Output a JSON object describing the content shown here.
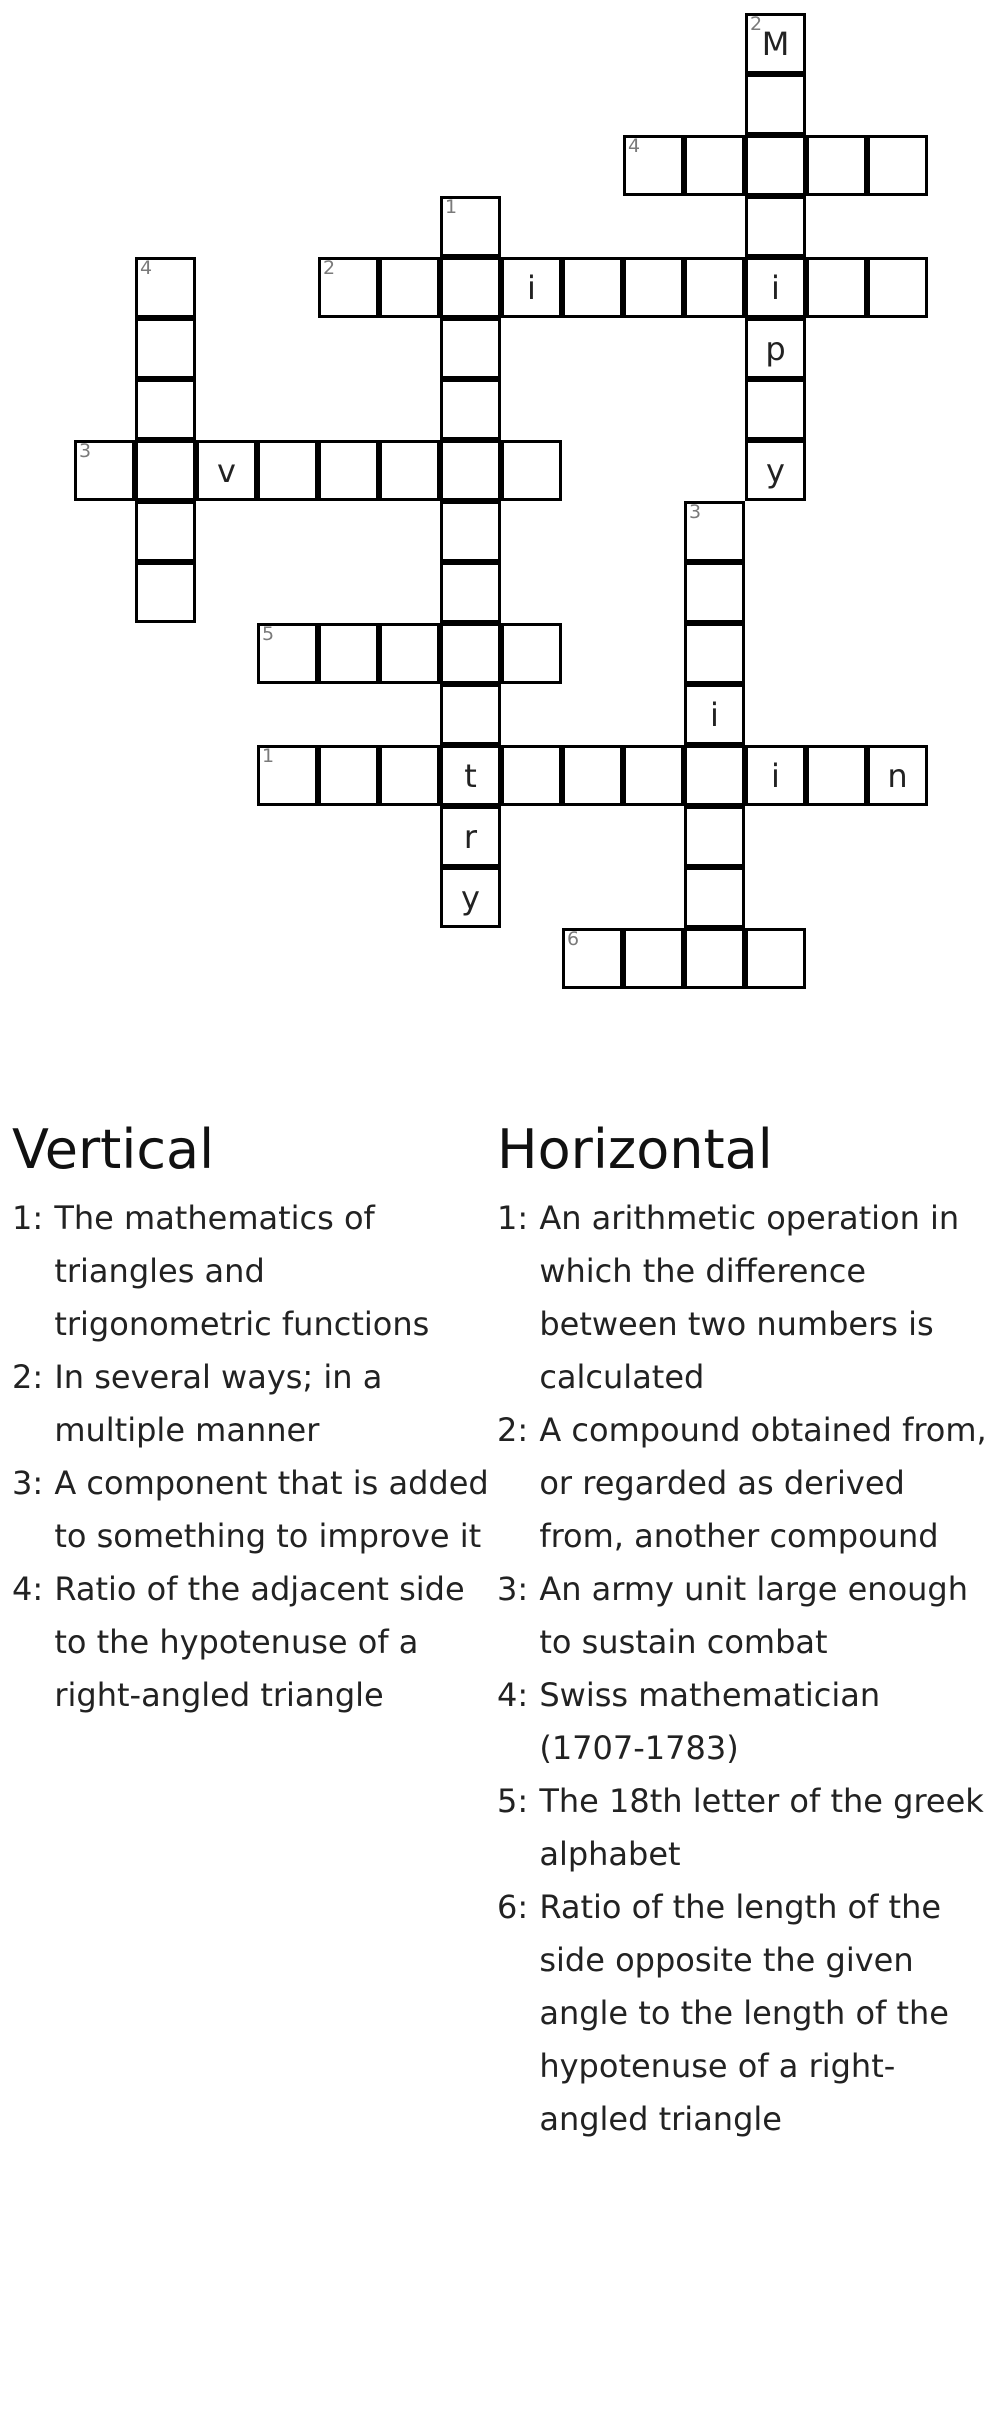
{
  "crossword": {
    "cells": [
      {
        "col": 12,
        "row": 0,
        "num": "2",
        "letter": "M"
      },
      {
        "col": 12,
        "row": 1
      },
      {
        "col": 10,
        "row": 2,
        "num": "4"
      },
      {
        "col": 11,
        "row": 2
      },
      {
        "col": 12,
        "row": 2
      },
      {
        "col": 13,
        "row": 2
      },
      {
        "col": 14,
        "row": 2
      },
      {
        "col": 7,
        "row": 3,
        "num": "1"
      },
      {
        "col": 12,
        "row": 3
      },
      {
        "col": 2,
        "row": 4,
        "num": "4"
      },
      {
        "col": 5,
        "row": 4,
        "num": "2"
      },
      {
        "col": 6,
        "row": 4
      },
      {
        "col": 7,
        "row": 4
      },
      {
        "col": 8,
        "row": 4,
        "letter": "i"
      },
      {
        "col": 9,
        "row": 4
      },
      {
        "col": 10,
        "row": 4
      },
      {
        "col": 11,
        "row": 4
      },
      {
        "col": 12,
        "row": 4,
        "letter": "i"
      },
      {
        "col": 13,
        "row": 4
      },
      {
        "col": 14,
        "row": 4
      },
      {
        "col": 2,
        "row": 5
      },
      {
        "col": 7,
        "row": 5
      },
      {
        "col": 12,
        "row": 5,
        "letter": "p"
      },
      {
        "col": 2,
        "row": 6
      },
      {
        "col": 7,
        "row": 6
      },
      {
        "col": 12,
        "row": 6
      },
      {
        "col": 1,
        "row": 7,
        "num": "3"
      },
      {
        "col": 2,
        "row": 7
      },
      {
        "col": 3,
        "row": 7,
        "letter": "v"
      },
      {
        "col": 4,
        "row": 7
      },
      {
        "col": 5,
        "row": 7
      },
      {
        "col": 6,
        "row": 7
      },
      {
        "col": 7,
        "row": 7
      },
      {
        "col": 8,
        "row": 7
      },
      {
        "col": 12,
        "row": 7,
        "letter": "y"
      },
      {
        "col": 2,
        "row": 8
      },
      {
        "col": 7,
        "row": 8
      },
      {
        "col": 11,
        "row": 8,
        "num": "3"
      },
      {
        "col": 2,
        "row": 9
      },
      {
        "col": 7,
        "row": 9
      },
      {
        "col": 11,
        "row": 9
      },
      {
        "col": 4,
        "row": 10,
        "num": "5"
      },
      {
        "col": 5,
        "row": 10
      },
      {
        "col": 6,
        "row": 10
      },
      {
        "col": 7,
        "row": 10
      },
      {
        "col": 8,
        "row": 10
      },
      {
        "col": 11,
        "row": 10
      },
      {
        "col": 7,
        "row": 11
      },
      {
        "col": 11,
        "row": 11,
        "letter": "i"
      },
      {
        "col": 4,
        "row": 12,
        "num": "1"
      },
      {
        "col": 5,
        "row": 12
      },
      {
        "col": 6,
        "row": 12
      },
      {
        "col": 7,
        "row": 12,
        "letter": "t"
      },
      {
        "col": 8,
        "row": 12
      },
      {
        "col": 9,
        "row": 12
      },
      {
        "col": 10,
        "row": 12
      },
      {
        "col": 11,
        "row": 12
      },
      {
        "col": 12,
        "row": 12,
        "letter": "i"
      },
      {
        "col": 13,
        "row": 12
      },
      {
        "col": 14,
        "row": 12,
        "letter": "n"
      },
      {
        "col": 7,
        "row": 13,
        "letter": "r"
      },
      {
        "col": 11,
        "row": 13
      },
      {
        "col": 7,
        "row": 14,
        "letter": "y"
      },
      {
        "col": 11,
        "row": 14
      },
      {
        "col": 9,
        "row": 15,
        "num": "6"
      },
      {
        "col": 10,
        "row": 15
      },
      {
        "col": 11,
        "row": 15
      },
      {
        "col": 12,
        "row": 15
      }
    ]
  },
  "clues": {
    "vertical": {
      "heading": "Vertical",
      "items": [
        {
          "num": "1:",
          "text": "The mathematics of triangles and trigonometric functions"
        },
        {
          "num": "2:",
          "text": "In several ways; in a multiple manner"
        },
        {
          "num": "3:",
          "text": "A component that is added to something to improve it"
        },
        {
          "num": "4:",
          "text": "Ratio of the adjacent side to the hypotenuse of a right-angled triangle"
        }
      ]
    },
    "horizontal": {
      "heading": "Horizontal",
      "items": [
        {
          "num": "1:",
          "text": "An arithmetic operation in which the difference between two numbers is calculated"
        },
        {
          "num": "2:",
          "text": "A compound obtained from, or regarded as derived from, another compound"
        },
        {
          "num": "3:",
          "text": "An army unit large enough to sustain combat"
        },
        {
          "num": "4:",
          "text": "Swiss mathematician (1707-1783)"
        },
        {
          "num": "5:",
          "text": "The 18th letter of the greek alphabet"
        },
        {
          "num": "6:",
          "text": "Ratio of the length of the side opposite the given angle to the length of the hypotenuse of a right-angled triangle"
        }
      ]
    }
  }
}
